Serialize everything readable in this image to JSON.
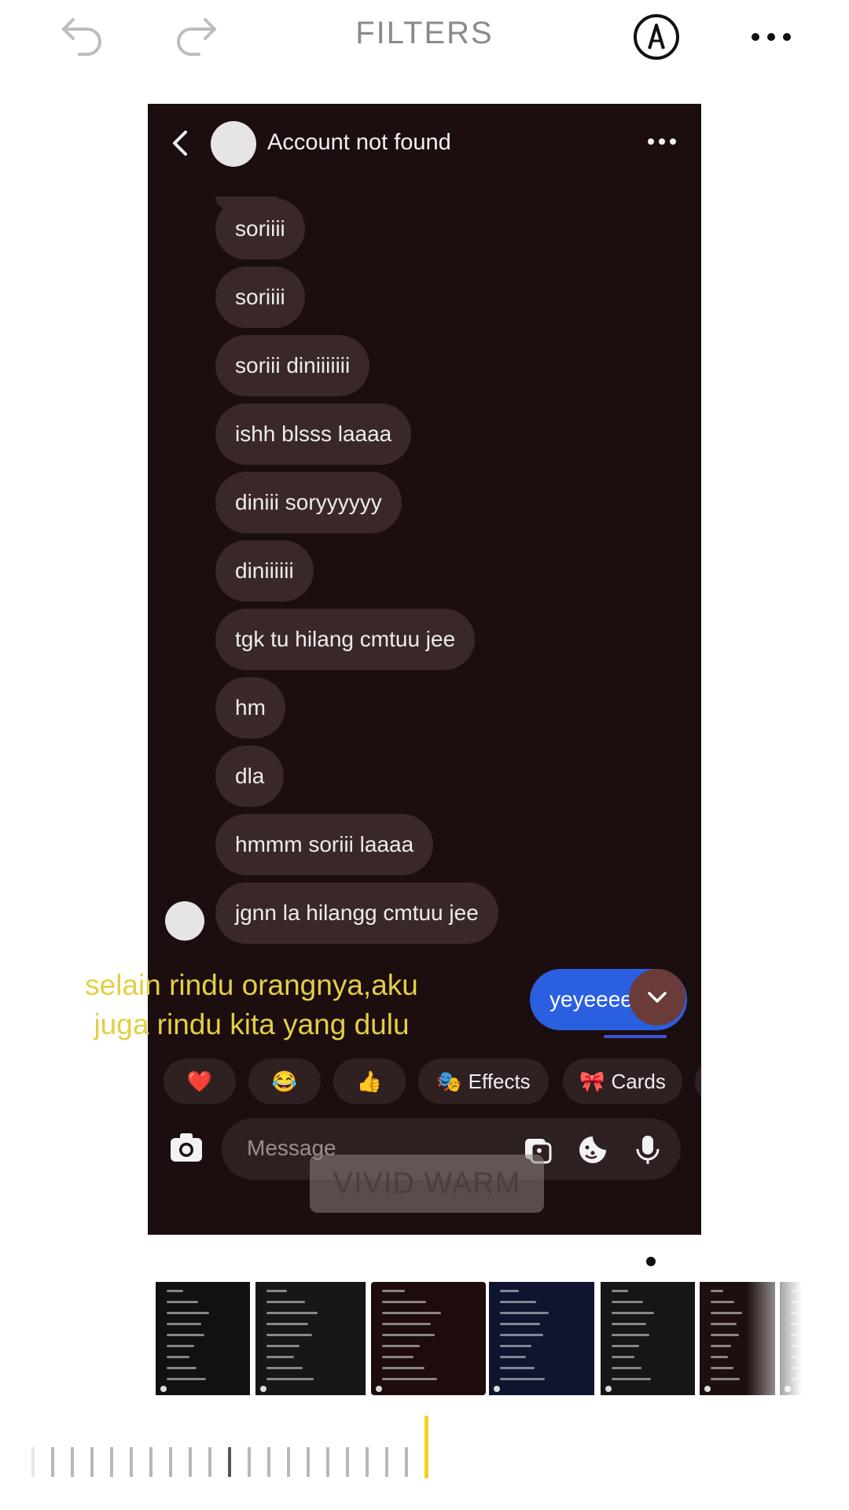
{
  "toolbar": {
    "title": "FILTERS",
    "undo_icon": "undo-arrow-icon",
    "redo_icon": "redo-arrow-icon",
    "markup_icon": "pen-markup-icon",
    "more_icon": "more-dots-icon"
  },
  "chat": {
    "header_name": "Account not found",
    "messages": [
      "soriiii",
      "soriiii",
      "soriii diniiiiiii",
      "ishh blsss laaaa",
      "diniii soryyyyyy",
      "diniiiiii",
      "tgk tu hilang cmtuu jee",
      "hm",
      "dla",
      "hmmm soriii laaaa",
      "jgnn la hilangg cmtuu jee"
    ],
    "my_message": "yeyeeee",
    "quick_reactions": [
      {
        "label": "",
        "icon": "❤️"
      },
      {
        "label": "",
        "icon": "😂"
      },
      {
        "label": "",
        "icon": "👍"
      },
      {
        "label": "Effects",
        "icon": "🎭"
      },
      {
        "label": "Cards",
        "icon": "🎀"
      }
    ],
    "message_placeholder": "Message"
  },
  "filter_name": "VIVID WARM",
  "caption": {
    "line1": "selain rindu orangnya,aku",
    "line2": "juga rindu kita yang dulu"
  },
  "filter_thumbnails": [
    {
      "name": "original",
      "color": "#111111"
    },
    {
      "name": "vivid",
      "color": "#171717"
    },
    {
      "name": "vivid-warm",
      "color": "#1e0b0c",
      "selected": true
    },
    {
      "name": "vivid-cool",
      "color": "#0f1530"
    },
    {
      "name": "dramatic",
      "color": "#161616"
    },
    {
      "name": "dramatic-warm",
      "color": "#1e0f0f"
    },
    {
      "name": "dramatic-cool",
      "color": "#1a1a1a"
    }
  ],
  "intensity": 1.0,
  "colors": {
    "caption": "#e2cf45",
    "accent": "#f2d21c",
    "my_bubble": "#2a5fe0",
    "peer_bubble": "#3a2829",
    "preview_bg": "#1c0d0e"
  }
}
